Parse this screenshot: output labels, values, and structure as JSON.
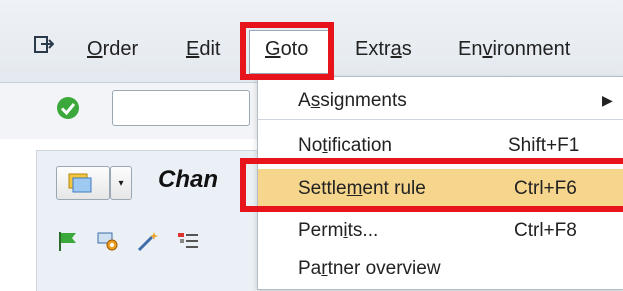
{
  "menubar": {
    "items": [
      {
        "pre": "",
        "u": "O",
        "post": "rder"
      },
      {
        "pre": "",
        "u": "E",
        "post": "dit"
      },
      {
        "pre": "",
        "u": "G",
        "post": "oto"
      },
      {
        "pre": "Extr",
        "u": "a",
        "post": "s"
      },
      {
        "pre": "En",
        "u": "v",
        "post": "ironment"
      }
    ]
  },
  "header": {
    "title": "Chan"
  },
  "goto_menu": {
    "items": [
      {
        "pre": "A",
        "u": "s",
        "post": "signments",
        "shortcut": "",
        "submenu": "▶"
      },
      {
        "pre": "No",
        "u": "t",
        "post": "ification",
        "shortcut": "Shift+F1",
        "submenu": ""
      },
      {
        "pre": "Settle",
        "u": "m",
        "post": "ent rule",
        "shortcut": "Ctrl+F6",
        "submenu": ""
      },
      {
        "pre": "Perm",
        "u": "i",
        "post": "ts...",
        "shortcut": "Ctrl+F8",
        "submenu": ""
      },
      {
        "pre": "Pa",
        "u": "r",
        "post": "tner overview",
        "shortcut": "",
        "submenu": ""
      }
    ]
  },
  "colors": {
    "highlight_box": "#e8141b",
    "selected_row": "#f6d58d",
    "check_green": "#3aa83a"
  },
  "icons": [
    "exit-menu-icon",
    "enter-check-icon",
    "flag-icon",
    "settings-gear-icon",
    "magic-wand-icon",
    "structure-icon"
  ]
}
